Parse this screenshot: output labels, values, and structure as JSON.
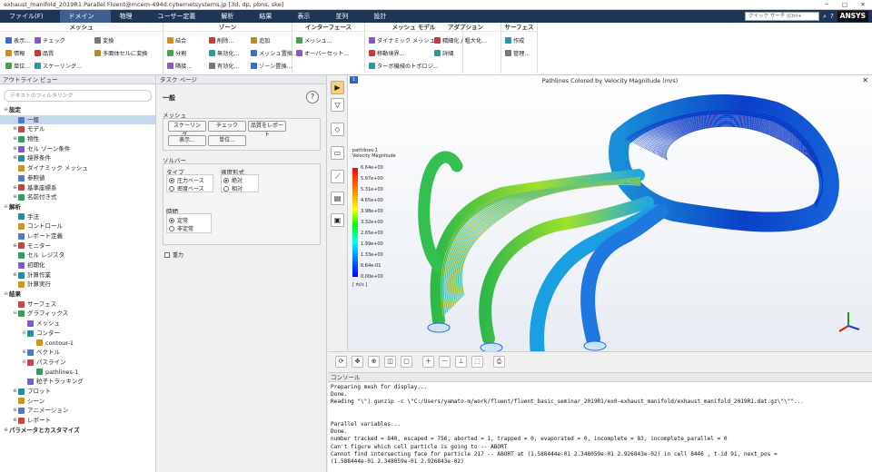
{
  "window": {
    "title": "exhaust_manifold_2019R1 Parallel Fluent@mcem-494d.cybernetsystems.jp  [3d, dp, pbns, ske]"
  },
  "menu": {
    "items": [
      "ファイル(F)",
      "ドメイン",
      "物理",
      "ユーザー定義",
      "解析",
      "結果",
      "表示",
      "並列",
      "設計"
    ],
    "active": "ドメイン",
    "search_placeholder": "クイック サーチ (Ctrl+",
    "brand": "ANSYS"
  },
  "ribbon": {
    "groups": [
      {
        "title": "メッシュ",
        "buttons": [
          "表示...",
          "情報",
          "単位...",
          "チェック",
          "品質",
          "スケーリング...",
          "変換",
          "多面体セルに変換"
        ]
      },
      {
        "title": "ゾーン",
        "buttons": [
          "結合",
          "分割",
          "隣接...",
          "削除...",
          "無効化...",
          "有効化...",
          "追加",
          "メッシュ置換...",
          "ゾーン置換..."
        ]
      },
      {
        "title": "インターフェース",
        "buttons": [
          "メッシュ...",
          "オーバーセット..."
        ]
      },
      {
        "title": "メッシュ モデル",
        "buttons": [
          "ダイナミック メッシュ...",
          "移動境界...",
          "ターボ機械のトポロジ..."
        ]
      },
      {
        "title": "アダプション",
        "buttons": [
          "精細化 / 粗大化...",
          "詳細"
        ]
      },
      {
        "title": "サーフェス",
        "buttons": [
          "作成",
          "管理..."
        ]
      }
    ]
  },
  "outline": {
    "header": "アウトライン ビュー",
    "filter_placeholder": "テキストのフィルタリング",
    "items": [
      {
        "label": "設定",
        "level": 0,
        "bold": true,
        "exp": "⊖"
      },
      {
        "label": "一般",
        "level": 1,
        "sel": true
      },
      {
        "label": "モデル",
        "level": 1,
        "exp": "⊕"
      },
      {
        "label": "物性",
        "level": 1,
        "exp": "⊕"
      },
      {
        "label": "セル ゾーン条件",
        "level": 1,
        "exp": "⊕"
      },
      {
        "label": "境界条件",
        "level": 1,
        "exp": "⊕"
      },
      {
        "label": "ダイナミック メッシュ",
        "level": 1
      },
      {
        "label": "参照値",
        "level": 1
      },
      {
        "label": "基準座標系",
        "level": 1,
        "exp": "⊕"
      },
      {
        "label": "名前付き式",
        "level": 1,
        "exp": "⊕"
      },
      {
        "label": "解析",
        "level": 0,
        "bold": true,
        "exp": "⊖"
      },
      {
        "label": "手法",
        "level": 1
      },
      {
        "label": "コントロール",
        "level": 1
      },
      {
        "label": "レポート定義",
        "level": 1
      },
      {
        "label": "モニター",
        "level": 1,
        "exp": "⊕"
      },
      {
        "label": "セル レジスタ",
        "level": 1
      },
      {
        "label": "初期化",
        "level": 1
      },
      {
        "label": "計算作業",
        "level": 1,
        "exp": "⊕"
      },
      {
        "label": "計算実行",
        "level": 1
      },
      {
        "label": "結果",
        "level": 0,
        "bold": true,
        "exp": "⊖"
      },
      {
        "label": "サーフェス",
        "level": 1
      },
      {
        "label": "グラフィックス",
        "level": 1,
        "exp": "⊖"
      },
      {
        "label": "メッシュ",
        "level": 2
      },
      {
        "label": "コンター",
        "level": 2,
        "exp": "⊖"
      },
      {
        "label": "contour-1",
        "level": 3
      },
      {
        "label": "ベクトル",
        "level": 2,
        "exp": "⊕"
      },
      {
        "label": "パスライン",
        "level": 2,
        "exp": "⊖"
      },
      {
        "label": "pathlines-1",
        "level": 3
      },
      {
        "label": "粒子トラッキング",
        "level": 2
      },
      {
        "label": "プロット",
        "level": 1,
        "exp": "⊕"
      },
      {
        "label": "シーン",
        "level": 1
      },
      {
        "label": "アニメーション",
        "level": 1,
        "exp": "⊕"
      },
      {
        "label": "レポート",
        "level": 1,
        "exp": "⊕"
      },
      {
        "label": "パラメータとカスタマイズ",
        "level": 0,
        "bold": true,
        "exp": "⊕"
      }
    ]
  },
  "task": {
    "header": "タスク ページ",
    "title": "一般",
    "mesh_label": "メッシュ",
    "btn_scaling": "スケーリング...",
    "btn_check": "チェック",
    "btn_report": "品質をレポート",
    "btn_display": "表示...",
    "btn_units": "単位...",
    "solver_label": "ソルバー",
    "type_label": "タイプ",
    "type_opt1": "圧力ベース",
    "type_opt2": "密度ベース",
    "vel_label": "速度形式",
    "vel_opt1": "絶対",
    "vel_opt2": "相対",
    "time_label": "時間",
    "time_opt1": "定常",
    "time_opt2": "非定常",
    "gravity_label": "重力"
  },
  "viewport": {
    "title": "Pathlines Colored by Velocity Magnitude (m/s)",
    "tab": "1",
    "legend_title1": "pathlines-1",
    "legend_title2": "Velocity Magnitude",
    "legend_ticks": [
      "6.64e+00",
      "5.97e+00",
      "5.31e+00",
      "4.65e+00",
      "3.98e+00",
      "3.32e+00",
      "2.65e+00",
      "1.99e+00",
      "1.33e+00",
      "6.64e-01",
      "0.00e+00"
    ],
    "unit": "[ m/s ]"
  },
  "console": {
    "header": "コンソール",
    "lines": [
      "Preparing mesh for display...",
      "Done.",
      "Reading \"\\\"| gunzip -c \\\"C:/Users/yamato-m/work/fluent/fluent_basic_seminar_2019R1/ex0-exhaust_manifold/exhaust_manifold_2019R1.dat.gz\\\"\\\"\"...",
      "",
      "",
      "Parallel variables...",
      "Done.",
      "number tracked = 840, escaped = 756, aborted = 1, trapped = 0, evaporated = 0, incomplete = 83, incomplete_parallel = 0",
      "Can't figure which cell particle is going to -- ABORT",
      "Cannot find intersecting face for particle 217 -- ABORT at (1.588444e-01 2.348059e-01 2.926843e-02) in cell 8446 , t-id 91, next_pos =",
      "(1.588444e-01 2.348059e-01 2.926843e-02)"
    ]
  }
}
